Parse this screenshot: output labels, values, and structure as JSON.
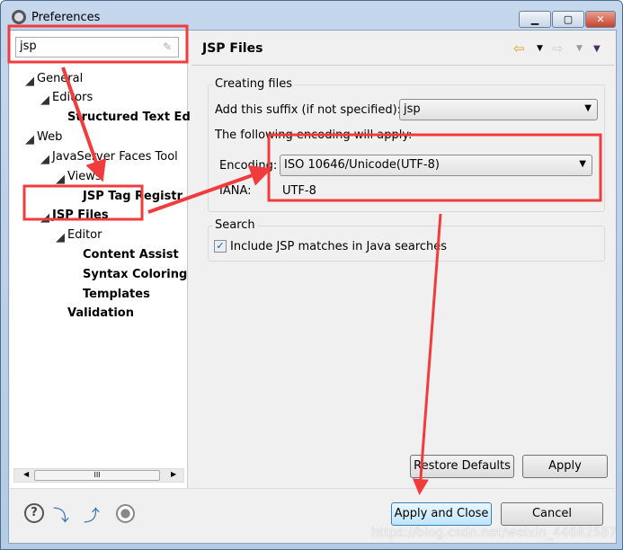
{
  "window": {
    "title": "Preferences",
    "minimize": "▁",
    "maximize": "▢",
    "close": "✕"
  },
  "search": {
    "value": "jsp"
  },
  "tree": [
    {
      "label": "General",
      "bold": false,
      "arrow": true
    },
    {
      "label": "Editors",
      "bold": false,
      "arrow": true
    },
    {
      "label": "Structured Text Ed",
      "bold": true,
      "arrow": false
    },
    {
      "label": "Web",
      "bold": false,
      "arrow": true
    },
    {
      "label": "JavaServer Faces Tool",
      "bold": false,
      "arrow": true
    },
    {
      "label": "Views",
      "bold": false,
      "arrow": true
    },
    {
      "label": "JSP Tag Registr",
      "bold": true,
      "arrow": false
    },
    {
      "label": "JSP Files",
      "bold": true,
      "arrow": true,
      "selected": true
    },
    {
      "label": "Editor",
      "bold": false,
      "arrow": true
    },
    {
      "label": "Content Assist",
      "bold": true,
      "arrow": false
    },
    {
      "label": "Syntax Coloring",
      "bold": true,
      "arrow": false
    },
    {
      "label": "Templates",
      "bold": true,
      "arrow": false
    },
    {
      "label": "Validation",
      "bold": true,
      "arrow": false
    }
  ],
  "scrollbar_thumb": "III",
  "page": {
    "title": "JSP Files",
    "creating": {
      "legend": "Creating files",
      "suffix_label": "Add this suffix (if not specified):",
      "suffix_value": "jsp",
      "encoding_note": "The following encoding will apply:",
      "encoding_label": "Encoding:",
      "encoding_value": "ISO 10646/Unicode(UTF-8)",
      "iana_label": "IANA:",
      "iana_value": "UTF-8"
    },
    "search": {
      "legend": "Search",
      "checkbox_label": "Include JSP matches in Java searches",
      "checked": true
    },
    "restore_defaults": "Restore Defaults",
    "apply": "Apply"
  },
  "footer": {
    "apply_close": "Apply and Close",
    "cancel": "Cancel",
    "icons": [
      "help-icon",
      "import-icon",
      "export-icon",
      "record-icon"
    ]
  },
  "watermark": "https://blog.csdn.net/weixin_44682587",
  "colors": {
    "annotation": "#f03c3c",
    "selected": "#ffffff"
  }
}
